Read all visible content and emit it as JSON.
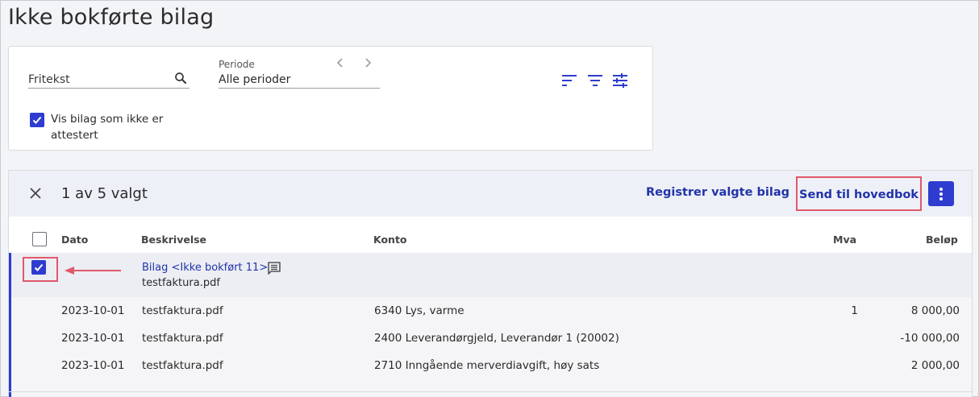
{
  "page": {
    "title": "Ikke bokførte bilag"
  },
  "filters": {
    "search_placeholder": "Fritekst",
    "period_label": "Periode",
    "period_value": "Alle perioder",
    "show_unattested_label": "Vis bilag som ikke er attestert",
    "show_unattested_checked": true
  },
  "selection": {
    "count_text": "1 av 5 valgt",
    "register_label": "Registrer valgte bilag",
    "send_label": "Send til hovedbok"
  },
  "table": {
    "headers": {
      "date": "Dato",
      "description": "Beskrivelse",
      "account": "Konto",
      "vat": "Mva",
      "amount": "Beløp"
    },
    "group": {
      "title": "Bilag <Ikke bokført 11>",
      "file": "testfaktura.pdf",
      "checked": true
    },
    "rows": [
      {
        "date": "2023-10-01",
        "description": "testfaktura.pdf",
        "account": "6340 Lys, varme",
        "vat": "1",
        "amount": "8 000,00"
      },
      {
        "date": "2023-10-01",
        "description": "testfaktura.pdf",
        "account": "2400 Leverandørgjeld, Leverandør 1 (20002)",
        "vat": "",
        "amount": "-10 000,00"
      },
      {
        "date": "2023-10-01",
        "description": "testfaktura.pdf",
        "account": "2710 Inngående merverdiavgift, høy sats",
        "vat": "",
        "amount": "2 000,00"
      }
    ]
  },
  "colors": {
    "accent": "#2e3ccf",
    "link": "#2233a8",
    "highlight": "#e0596b"
  }
}
